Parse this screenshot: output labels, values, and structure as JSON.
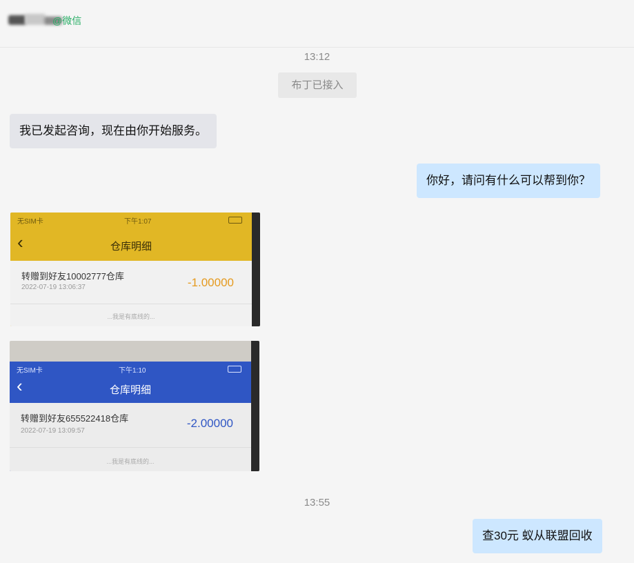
{
  "header": {
    "wechat_tag": "@微信"
  },
  "messages": {
    "time1": "13:12",
    "system_note": "布丁已接入",
    "left_text": "我已发起咨询，现在由你开始服务。",
    "right_text": "你好，请问有什么可以帮到你？",
    "time2": "13:55",
    "final_text": "查30元 蚁从联盟回收"
  },
  "screenshot1": {
    "status_carrier": "无SIM卡",
    "status_time": "下午1:07",
    "title": "仓库明细",
    "item": "转赠到好友10002777仓库",
    "date": "2022-07-19 13:06:37",
    "amount": "-1.00000",
    "footer": "...我是有底线的...",
    "theme_color": "#e1b725",
    "amount_color": "#e59a1f"
  },
  "screenshot2": {
    "status_carrier": "无SIM卡",
    "status_time": "下午1:10",
    "title": "仓库明细",
    "item": "转赠到好友655522418仓库",
    "date": "2022-07-19 13:09:57",
    "amount": "-2.00000",
    "footer": "...我是有底线的...",
    "theme_color": "#2f56c4",
    "amount_color": "#2f56c4"
  }
}
